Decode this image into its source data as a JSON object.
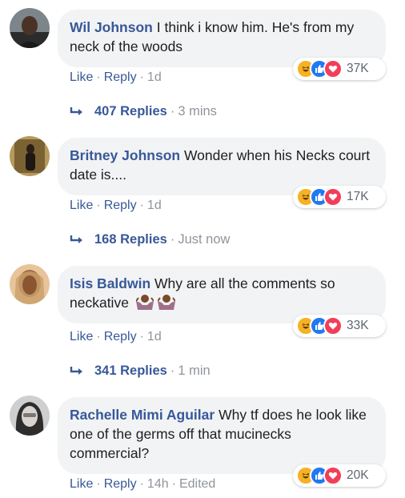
{
  "colors": {
    "link": "#385898",
    "meta": "#90949c",
    "bubble": "#f2f3f5",
    "haha": "#f7b125",
    "like": "#2078f4",
    "love": "#f33e58"
  },
  "comments": [
    {
      "author": "Wil Johnson",
      "text": "I think i know him. He's from my neck of the woods",
      "reactions": {
        "icons": [
          "haha-icon",
          "like-icon",
          "love-icon"
        ],
        "count": "37K"
      },
      "actions": {
        "like": "Like",
        "reply": "Reply",
        "time": "1d"
      },
      "replies": {
        "label": "407 Replies",
        "time": "3 mins"
      }
    },
    {
      "author": "Britney Johnson",
      "text": "Wonder when his Necks court date is....",
      "reactions": {
        "icons": [
          "haha-icon",
          "like-icon",
          "love-icon"
        ],
        "count": "17K"
      },
      "actions": {
        "like": "Like",
        "reply": "Reply",
        "time": "1d"
      },
      "replies": {
        "label": "168 Replies",
        "time": "Just now"
      }
    },
    {
      "author": "Isis Baldwin",
      "text": "Why are all the comments so neckative",
      "emoji": [
        "shrug-emoji",
        "shrug-emoji"
      ],
      "reactions": {
        "icons": [
          "haha-icon",
          "like-icon",
          "love-icon"
        ],
        "count": "33K"
      },
      "actions": {
        "like": "Like",
        "reply": "Reply",
        "time": "1d"
      },
      "replies": {
        "label": "341 Replies",
        "time": "1 min"
      }
    },
    {
      "author": "Rachelle Mimi Aguilar",
      "text": "Why tf does he look like one of the germs off that mucinecks commercial?",
      "reactions": {
        "icons": [
          "haha-icon",
          "like-icon",
          "love-icon"
        ],
        "count": "20K"
      },
      "actions": {
        "like": "Like",
        "reply": "Reply",
        "time": "14h",
        "edited": "Edited"
      }
    }
  ]
}
